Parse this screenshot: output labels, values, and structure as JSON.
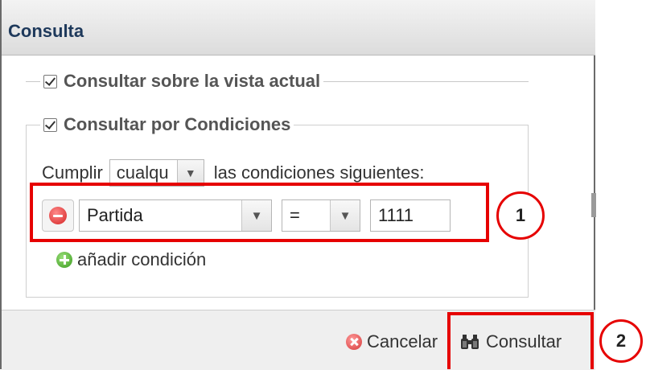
{
  "dialog": {
    "title": "Consulta",
    "vista_actual": {
      "label": "Consultar sobre la vista actual",
      "checked": true
    },
    "condiciones": {
      "label": "Consultar por Condiciones",
      "checked": true
    }
  },
  "cumplir": {
    "prefix": "Cumplir",
    "combo_value": "cualqu",
    "suffix": "las condiciones siguientes:"
  },
  "condition": {
    "field": "Partida",
    "operator": "=",
    "value": "1111"
  },
  "add_condition": "añadir condición",
  "footer": {
    "cancel_label": "Cancelar",
    "submit_label": "Consultar"
  },
  "annotations": {
    "marker_1": "1",
    "marker_2": "2",
    "color": "#e60000"
  },
  "icons": {
    "remove": "remove-circle-icon",
    "add": "add-circle-icon",
    "cancel": "cancel-circle-icon",
    "submit": "binoculars-icon",
    "dropdown": "chevron-down-icon"
  }
}
